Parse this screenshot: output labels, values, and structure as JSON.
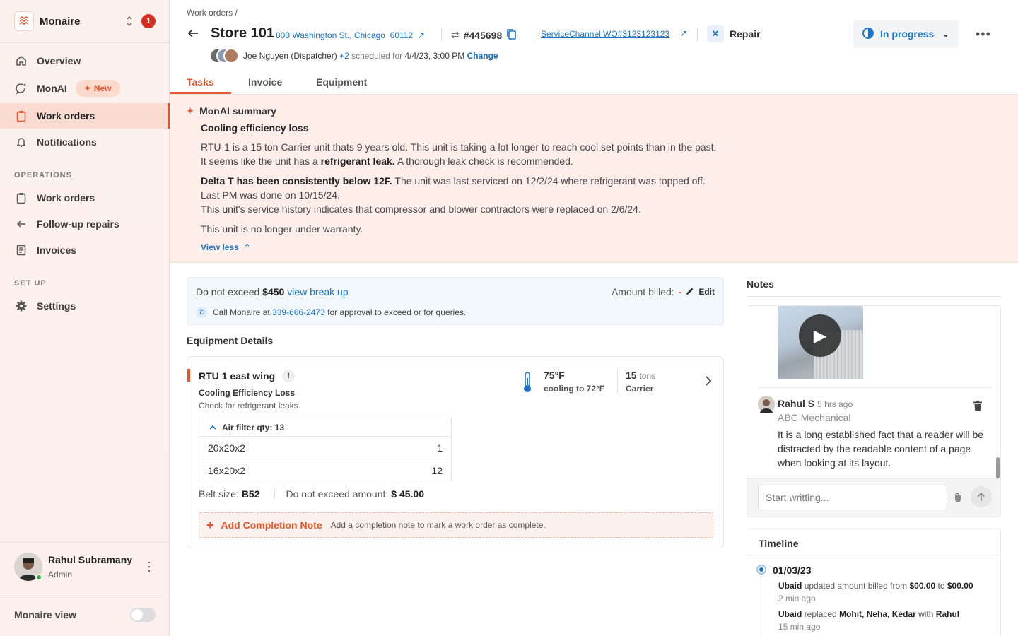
{
  "sidebar": {
    "org_name": "Monaire",
    "notification_count": "1",
    "nav": [
      {
        "label": "Overview"
      },
      {
        "label": "MonAI",
        "badge": "New"
      },
      {
        "label": "Work orders"
      },
      {
        "label": "Notifications"
      }
    ],
    "operations_heading": "OPERATIONS",
    "operations": [
      {
        "label": "Work orders"
      },
      {
        "label": "Follow-up repairs"
      },
      {
        "label": "Invoices"
      }
    ],
    "setup_heading": "SET UP",
    "setup": [
      {
        "label": "Settings"
      }
    ],
    "user": {
      "name": "Rahul Subramany",
      "role": "Admin"
    },
    "monaire_view_label": "Monaire view",
    "monaire_view_on": false
  },
  "header": {
    "breadcrumb": "Work orders /",
    "store": "Store 101",
    "address": "800 Washington St., Chicago",
    "zip": "60112",
    "wo_number": "#445698",
    "servicechannel": "ServiceChannel WO#3123123123",
    "type": "Repair",
    "status": "In progress",
    "dispatcher": "Joe Nguyen (Dispatcher)",
    "extra_count": "+2",
    "scheduled_for": "scheduled for",
    "scheduled_date": "4/4/23, 3:00 PM",
    "change_label": "Change"
  },
  "tabs": [
    {
      "label": "Tasks",
      "active": true
    },
    {
      "label": "Invoice"
    },
    {
      "label": "Equipment"
    }
  ],
  "summary": {
    "heading": "MonAI summary",
    "title": "Cooling efficiency loss",
    "p1_line1": "RTU-1 is a 15 ton Carrier unit thats 9 years old. This unit is taking a lot longer to reach cool set points than in the past.",
    "p1_line2_pre": "It seems like the unit has a ",
    "p1_line2_bold": "refrigerant leak.",
    "p1_line2_post": " A thorough leak check is recommended.",
    "p2_bold": "Delta T has been consistently below 12F.",
    "p2_line1_post": " The unit was last serviced on 12/2/24 where refrigerant was topped off.",
    "p2_line2": "Last PM was done on 10/15/24.",
    "p2_line3": "This unit's service history indicates that compressor and blower contractors were replaced on 2/6/24.",
    "p3": "This unit is no longer under warranty.",
    "toggle_label": "View less"
  },
  "budget": {
    "dne_label": "Do not exceed",
    "dne_amount": "$450",
    "breakup_link": "view break up",
    "billed_label": "Amount billed:",
    "billed_value": "-",
    "edit_label": "Edit",
    "call_pre": "Call Monaire at",
    "phone": "339-666-2473",
    "call_post": "for approval to exceed or for queries."
  },
  "equipment": {
    "heading": "Equipment Details",
    "name": "RTU 1 east wing",
    "issue": "Cooling Efficiency Loss",
    "instruction": "Check for refrigerant leaks.",
    "temp": "75°F",
    "cooling_to": "cooling to 72°F",
    "tons_value": "15",
    "tons_unit": "tons",
    "brand": "Carrier",
    "filter_heading": "Air filter qty: 13",
    "filters": [
      {
        "size": "20x20x2",
        "qty": "1"
      },
      {
        "size": "16x20x2",
        "qty": "12"
      }
    ],
    "belt_label": "Belt size:",
    "belt_value": "B52",
    "dne_amount_label": "Do not exceed amount:",
    "dne_amount_value": "$ 45.00",
    "completion_label": "Add Completion Note",
    "completion_hint": "Add a completion note to mark a work order as complete."
  },
  "notes": {
    "heading": "Notes",
    "author": "Rahul S",
    "time": "5 hrs ago",
    "company": "ABC Mechanical",
    "body": "It is a long established fact that a reader will be distracted by the readable content of a page when looking at its layout.",
    "input_placeholder": "Start writting..."
  },
  "timeline": {
    "heading": "Timeline",
    "date": "01/03/23",
    "events": [
      {
        "actor": "Ubaid",
        "verb": "updated amount billed from",
        "from": "$00.00",
        "to_word": "to",
        "to": "$00.00",
        "ago": "2 min ago"
      },
      {
        "actor": "Ubaid",
        "verb": "replaced",
        "from": "Mohit, Neha, Kedar",
        "to_word": "with",
        "to": "Rahul",
        "ago": "15 min ago"
      }
    ]
  },
  "colors": {
    "accent": "#e8542b",
    "link": "#1a73c8",
    "badge": "#d92d20"
  }
}
